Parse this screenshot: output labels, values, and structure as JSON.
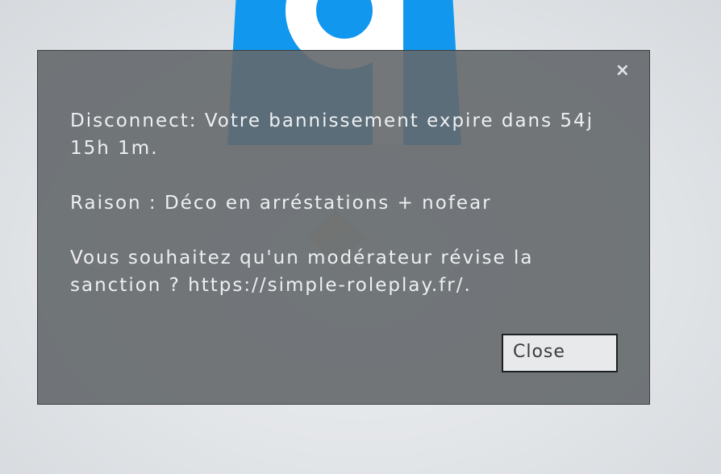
{
  "dialog": {
    "close_x": "×",
    "line1": "Disconnect: Votre bannissement expire dans 54j 15h 1m.",
    "line2": "Raison : Déco en arréstations + nofear",
    "line3": "Vous souhaitez qu'un modérateur révise la sanction ? https://simple-roleplay.fr/.",
    "close_label": "Close"
  },
  "colors": {
    "logo_blue": "#1197ee",
    "dialog_bg": "#64686c",
    "button_bg": "#e8e9ea"
  }
}
